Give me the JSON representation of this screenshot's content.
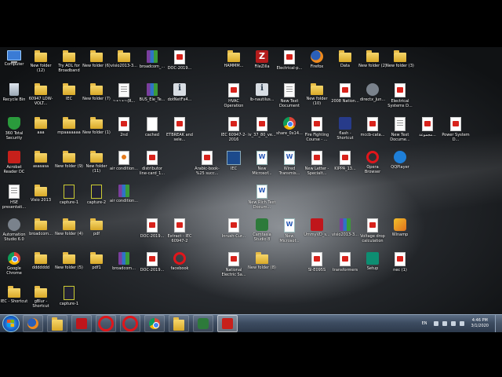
{
  "desktop": {
    "icons": [
      {
        "label": "Computer",
        "type": "computer"
      },
      {
        "label": "New folder (12)",
        "type": "folder"
      },
      {
        "label": "Try AOL for Broadband",
        "type": "folder"
      },
      {
        "label": "New folder (6)",
        "type": "folder"
      },
      {
        "label": "visio2013-3...",
        "type": "folder"
      },
      {
        "label": "broadcom_...",
        "type": "rar"
      },
      {
        "label": "DOC-2019...",
        "type": "pdf"
      },
      {
        "label": "HAMMM...",
        "type": "folder"
      },
      {
        "label": "FileZilla",
        "type": "filezilla"
      },
      {
        "label": "Electrical-p...",
        "type": "pdf"
      },
      {
        "label": "Firefox",
        "type": "firefox"
      },
      {
        "label": "Data",
        "type": "folder"
      },
      {
        "label": "New folder (2)",
        "type": "folder"
      },
      {
        "label": "New folder (3)",
        "type": "folder"
      },
      {
        "label": "Recycle Bin",
        "type": "bin"
      },
      {
        "label": "60947 LOW-VOLT...",
        "type": "folder"
      },
      {
        "label": "IEC",
        "type": "folder"
      },
      {
        "label": "New folder (7)",
        "type": "folder"
      },
      {
        "label": "~•~•~(R...",
        "type": "doc"
      },
      {
        "label": "BUS_Ele_Te...",
        "type": "rar"
      },
      {
        "label": "dotNetFx4...",
        "type": "info"
      },
      {
        "label": "HVAC Operation",
        "type": "pdf"
      },
      {
        "label": "lb-nautilus...",
        "type": "info"
      },
      {
        "label": "New Text Document",
        "type": "doc"
      },
      {
        "label": "New folder (10)",
        "type": "folder"
      },
      {
        "label": "2008 Nation...",
        "type": "pdf"
      },
      {
        "label": "directx_Jun...",
        "type": "settings"
      },
      {
        "label": "Electrical Systems D...",
        "type": "pdf"
      },
      {
        "label": "360 Total Security",
        "type": "shield"
      },
      {
        "label": "aaa",
        "type": "folder"
      },
      {
        "label": "mpaaaaaaa",
        "type": "folder"
      },
      {
        "label": "New folder (1)",
        "type": "folder"
      },
      {
        "label": "2nd",
        "type": "pdf"
      },
      {
        "label": "cached",
        "type": "blank"
      },
      {
        "label": "ETBREAK and sele...",
        "type": "pdf"
      },
      {
        "label": "IEC 60947-2-2016",
        "type": "pdf"
      },
      {
        "label": "iv_37_80_ve...",
        "type": "pdf"
      },
      {
        "label": "share_0x14...",
        "type": "chrome"
      },
      {
        "label": "Fire Fighting Course - ...",
        "type": "pdf"
      },
      {
        "label": "flash - Shortcut",
        "type": "media"
      },
      {
        "label": "mccb-cata...",
        "type": "pdf"
      },
      {
        "label": "New Text Docume...",
        "type": "doc"
      },
      {
        "label": "مجموعة...",
        "type": "pdf"
      },
      {
        "label": "Power System D...",
        "type": "pdf"
      },
      {
        "label": "Acrobat Reader DC",
        "type": "acrobat"
      },
      {
        "label": "asasasa",
        "type": "folder"
      },
      {
        "label": "New folder (9)",
        "type": "folder"
      },
      {
        "label": "New folder (11)",
        "type": "folder"
      },
      {
        "label": "air condition...",
        "type": "java"
      },
      {
        "label": "distributor line-card_1...",
        "type": "pdf"
      },
      {
        "label": "Arabic-book-%25 succ...",
        "type": "pdf"
      },
      {
        "label": "IEC",
        "type": "tv"
      },
      {
        "label": "New Microsof...",
        "type": "word"
      },
      {
        "label": "Wired Transmis...",
        "type": "word"
      },
      {
        "label": "New Letter - Specialt...",
        "type": "pdf"
      },
      {
        "label": "KIPPA_13...",
        "type": "pdf"
      },
      {
        "label": "Opera Browser",
        "type": "opera"
      },
      {
        "label": "QQPlayer",
        "type": "qq"
      },
      {
        "label": "HSE presentati...",
        "type": "doc"
      },
      {
        "label": "Visio 2013",
        "type": "folder"
      },
      {
        "label": "capture-1",
        "type": "capture"
      },
      {
        "label": "capture-2",
        "type": "capture"
      },
      {
        "label": "air condition...",
        "type": "rar"
      },
      {
        "label": "New Rich Text Docum...",
        "type": "word"
      },
      {
        "label": "Automation Studio 6.0",
        "type": "settings"
      },
      {
        "label": "broadcom...",
        "type": "folder"
      },
      {
        "label": "New folder (4)",
        "type": "folder"
      },
      {
        "label": "pdf",
        "type": "folder"
      },
      {
        "label": "DOC-2019...",
        "type": "pdf"
      },
      {
        "label": "Extract - IEC 60947-2",
        "type": "pdf"
      },
      {
        "label": "Inrush-Cur...",
        "type": "pdf"
      },
      {
        "label": "Camtasia Studio 8",
        "type": "cam"
      },
      {
        "label": "New Microsof...",
        "type": "word"
      },
      {
        "label": "UmmyVD_s...",
        "type": "video"
      },
      {
        "label": "visio2013-3...",
        "type": "rar"
      },
      {
        "label": "Voltage drop calculation",
        "type": "pdf"
      },
      {
        "label": "Winamp",
        "type": "winamp"
      },
      {
        "label": "Google Chrome",
        "type": "chrome"
      },
      {
        "label": "ddddddd",
        "type": "folder"
      },
      {
        "label": "New folder (5)",
        "type": "folder"
      },
      {
        "label": "pdf1",
        "type": "folder"
      },
      {
        "label": "broadcom...",
        "type": "rar"
      },
      {
        "label": "DOC-2019...",
        "type": "pdf"
      },
      {
        "label": "facebook",
        "type": "opera"
      },
      {
        "label": "National Electric Sa...",
        "type": "pdf"
      },
      {
        "label": "New folder (8)",
        "type": "folder"
      },
      {
        "label": "SI-E095S",
        "type": "pdf"
      },
      {
        "label": "transformers",
        "type": "pdf"
      },
      {
        "label": "Setup",
        "type": "setup"
      },
      {
        "label": "nec (1)",
        "type": "pdf"
      },
      {
        "label": "IEC - Shortcut",
        "type": "folder"
      },
      {
        "label": "gBlur - Shortcut",
        "type": "folder"
      },
      {
        "label": "capture-1",
        "type": "capture"
      }
    ]
  },
  "taskbar": {
    "apps": [
      {
        "name": "internet-explorer",
        "type": "firefox",
        "active": false
      },
      {
        "name": "file-explorer",
        "type": "folder",
        "active": false
      },
      {
        "name": "media-player",
        "type": "video",
        "active": false
      },
      {
        "name": "opera-1",
        "type": "opera",
        "active": false
      },
      {
        "name": "opera-2",
        "type": "opera",
        "active": false
      },
      {
        "name": "chrome",
        "type": "chrome",
        "active": false
      },
      {
        "name": "folder-window",
        "type": "folder",
        "active": false
      },
      {
        "name": "spreadsheet",
        "type": "cam",
        "active": false
      },
      {
        "name": "acrobat",
        "type": "acrobat",
        "active": true
      }
    ],
    "language": "EN",
    "time": "4:46 PM",
    "date": "3/1/2020"
  }
}
